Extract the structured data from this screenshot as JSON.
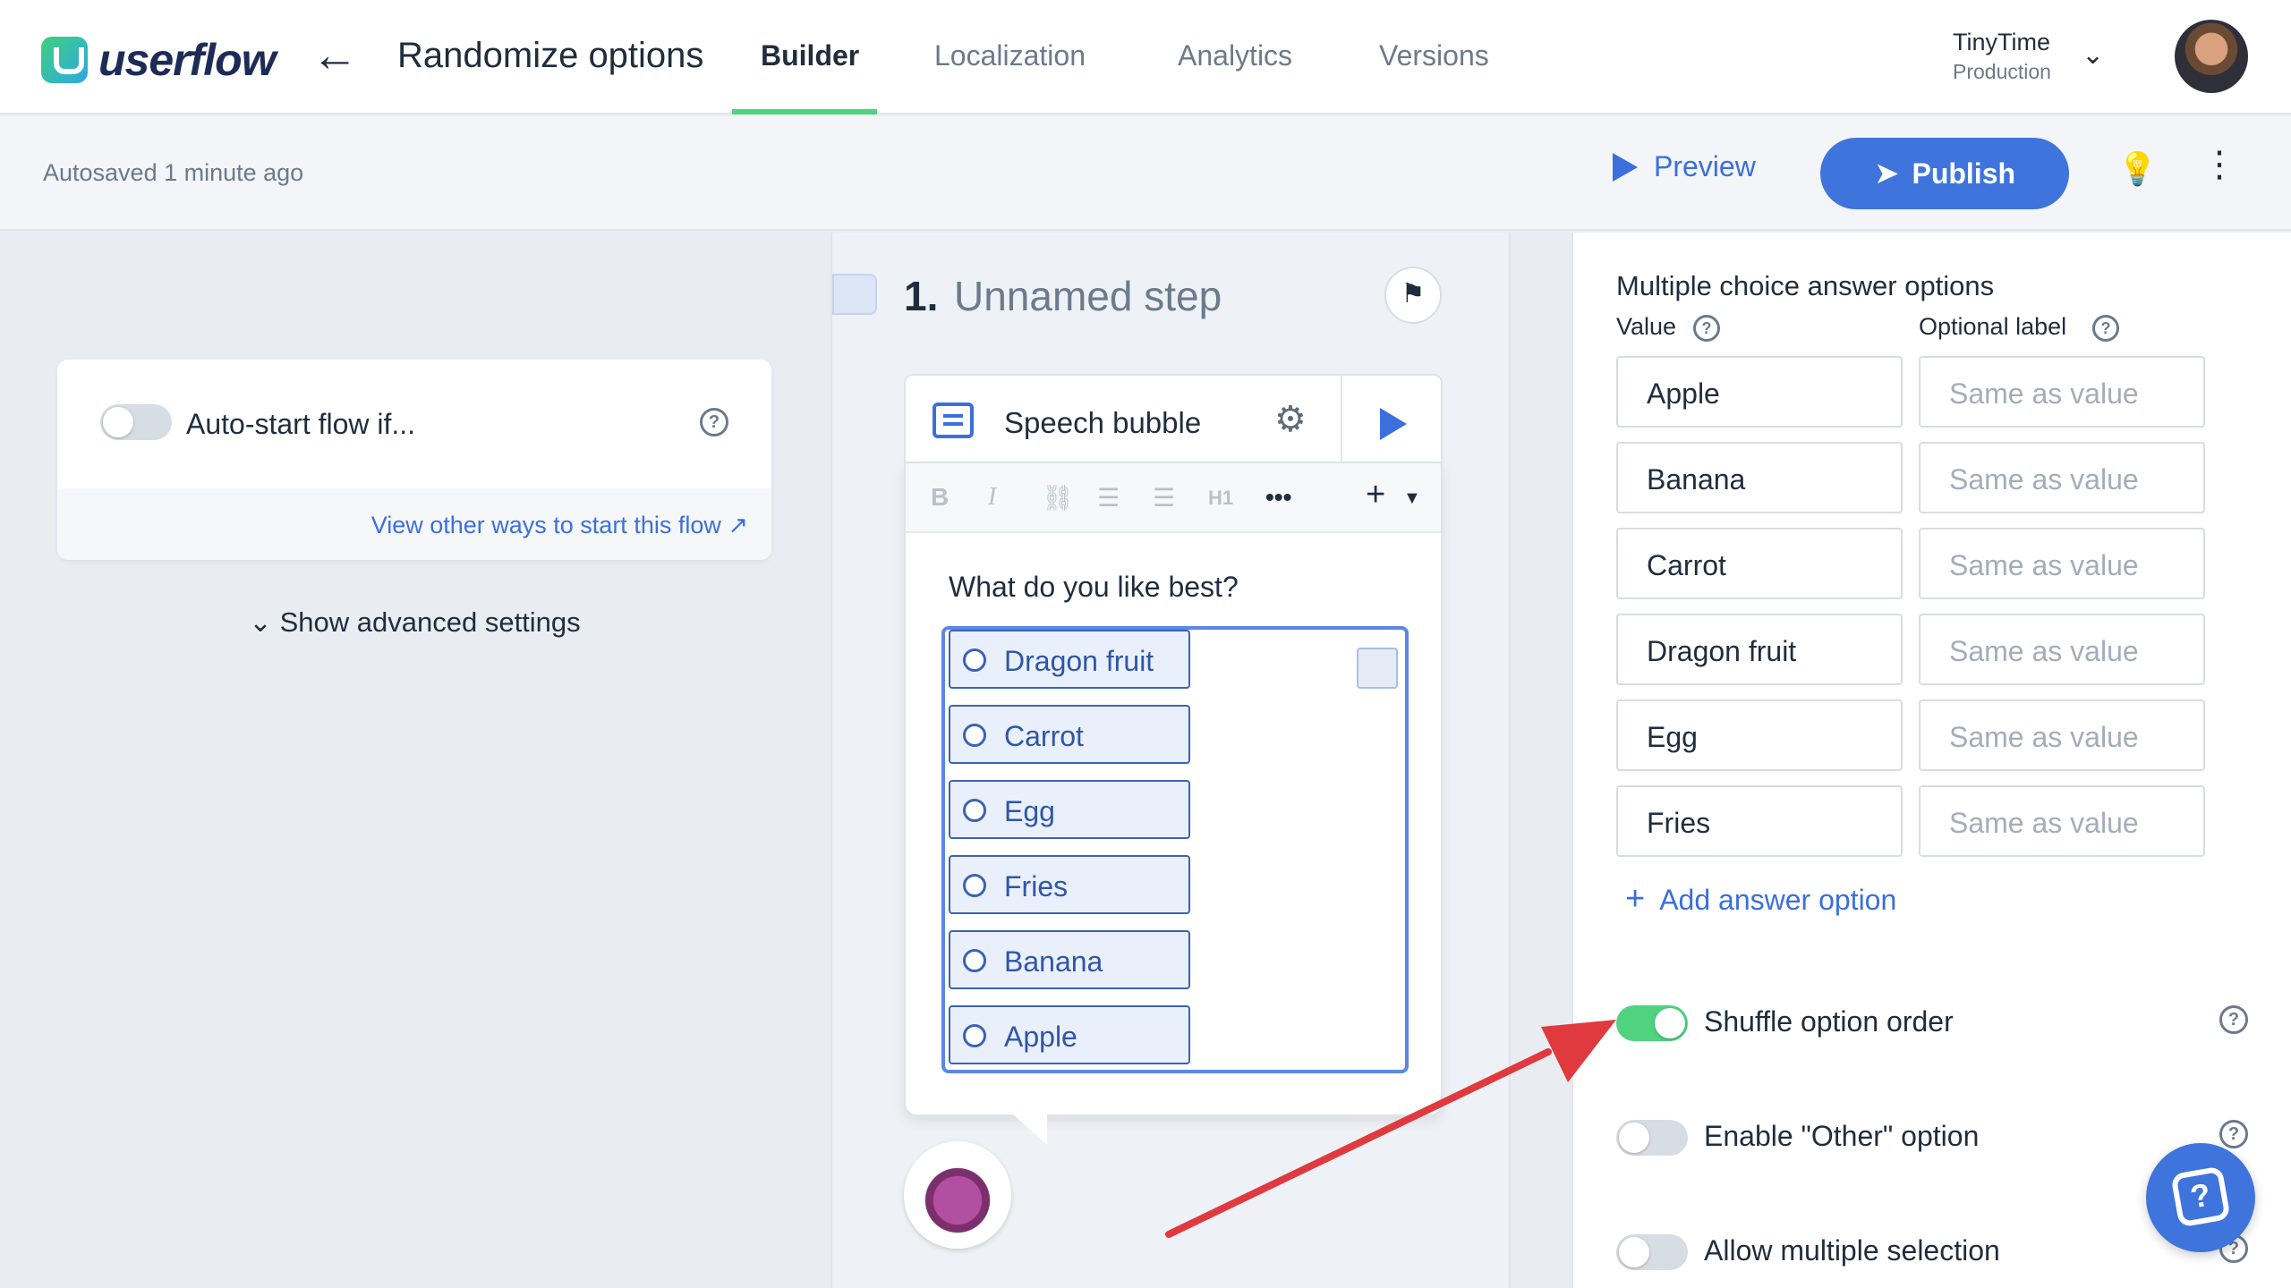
{
  "nav": {
    "logo_text": "userflow",
    "flow_title": "Randomize options",
    "tabs": [
      {
        "label": "Builder",
        "active": true
      },
      {
        "label": "Localization",
        "active": false
      },
      {
        "label": "Analytics",
        "active": false
      },
      {
        "label": "Versions",
        "active": false
      }
    ],
    "account_name": "TinyTime",
    "account_env": "Production"
  },
  "toolbar": {
    "autosave": "Autosaved 1 minute ago",
    "preview_label": "Preview",
    "publish_label": "Publish"
  },
  "left": {
    "trigger_label": "Auto-start flow if...",
    "trigger_enabled": false,
    "view_ways_link": "View other ways to start this flow",
    "show_advanced": "Show advanced settings"
  },
  "canvas": {
    "step_number": "1.",
    "step_name": "Unnamed step",
    "block_label": "Speech bubble",
    "question": "What do you like best?",
    "shown_options": [
      "Dragon fruit",
      "Carrot",
      "Egg",
      "Fries",
      "Banana",
      "Apple"
    ]
  },
  "right": {
    "section_title": "Multiple choice answer options",
    "value_header": "Value",
    "label_header": "Optional label",
    "label_placeholder": "Same as value",
    "values": [
      "Apple",
      "Banana",
      "Carrot",
      "Dragon fruit",
      "Egg",
      "Fries"
    ],
    "add_option": "Add answer option",
    "settings": [
      {
        "label": "Shuffle option order",
        "enabled": true
      },
      {
        "label": "Enable \"Other\" option",
        "enabled": false
      },
      {
        "label": "Allow multiple selection",
        "enabled": false
      }
    ]
  },
  "colors": {
    "accent": "#3e74dc",
    "toggle_on": "#4fd37f",
    "annotation_arrow": "#e0393e"
  }
}
